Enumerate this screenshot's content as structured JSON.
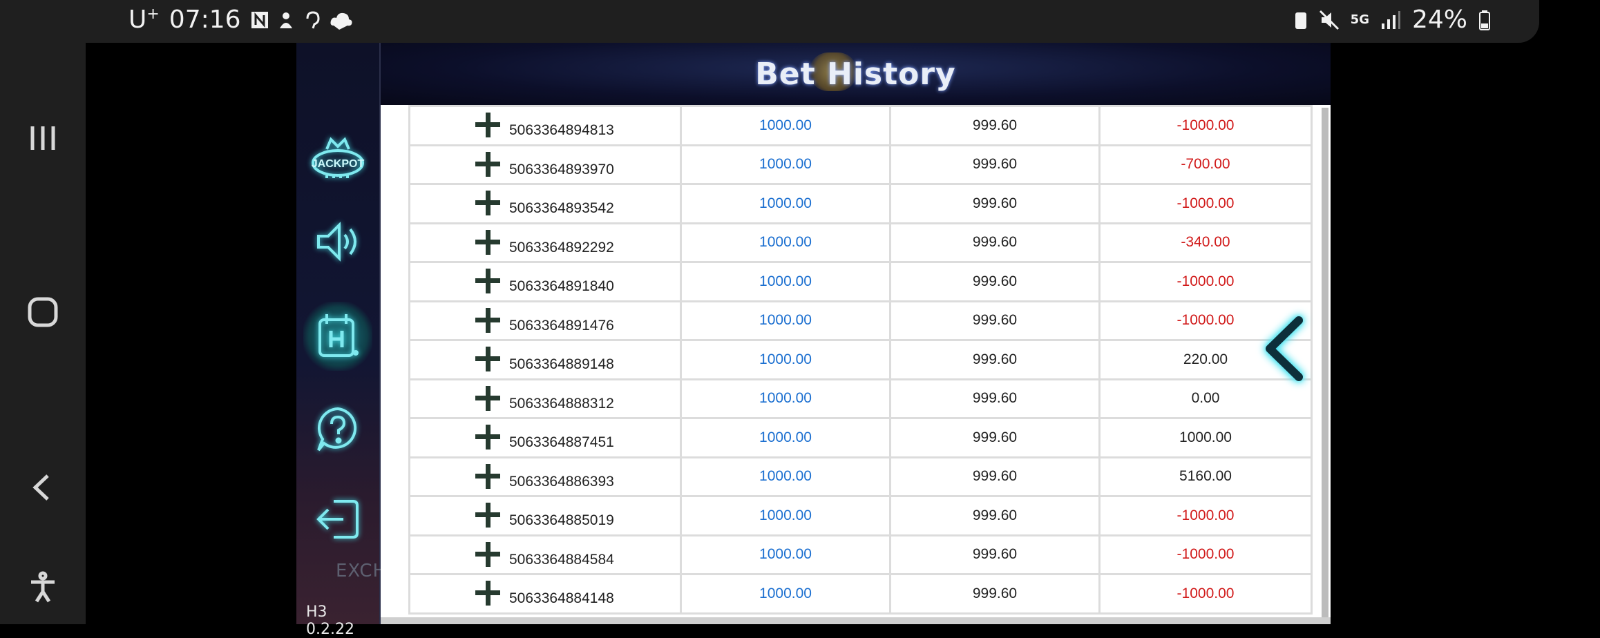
{
  "status_bar": {
    "carrier": "U",
    "carrier_sup": "+",
    "time": "07:16",
    "network": "5G",
    "battery": "24%"
  },
  "game": {
    "header_title": "Bet History",
    "version": "H3 0.2.22",
    "exchange_label": "EXCH",
    "sidebar": [
      {
        "name": "jackpot-icon",
        "label": "JACKPOT"
      },
      {
        "name": "sound-icon"
      },
      {
        "name": "history-icon"
      },
      {
        "name": "help-icon"
      },
      {
        "name": "exit-icon"
      }
    ]
  },
  "bets": [
    {
      "id": "5063364894813",
      "bet": "1000.00",
      "net": "999.60",
      "win": "-1000.00",
      "negative": true
    },
    {
      "id": "5063364893970",
      "bet": "1000.00",
      "net": "999.60",
      "win": "-700.00",
      "negative": true
    },
    {
      "id": "5063364893542",
      "bet": "1000.00",
      "net": "999.60",
      "win": "-1000.00",
      "negative": true
    },
    {
      "id": "5063364892292",
      "bet": "1000.00",
      "net": "999.60",
      "win": "-340.00",
      "negative": true
    },
    {
      "id": "5063364891840",
      "bet": "1000.00",
      "net": "999.60",
      "win": "-1000.00",
      "negative": true
    },
    {
      "id": "5063364891476",
      "bet": "1000.00",
      "net": "999.60",
      "win": "-1000.00",
      "negative": true
    },
    {
      "id": "5063364889148",
      "bet": "1000.00",
      "net": "999.60",
      "win": "220.00",
      "negative": false
    },
    {
      "id": "5063364888312",
      "bet": "1000.00",
      "net": "999.60",
      "win": "0.00",
      "negative": false
    },
    {
      "id": "5063364887451",
      "bet": "1000.00",
      "net": "999.60",
      "win": "1000.00",
      "negative": false
    },
    {
      "id": "5063364886393",
      "bet": "1000.00",
      "net": "999.60",
      "win": "5160.00",
      "negative": false
    },
    {
      "id": "5063364885019",
      "bet": "1000.00",
      "net": "999.60",
      "win": "-1000.00",
      "negative": true
    },
    {
      "id": "5063364884584",
      "bet": "1000.00",
      "net": "999.60",
      "win": "-1000.00",
      "negative": true
    },
    {
      "id": "5063364884148",
      "bet": "1000.00",
      "net": "999.60",
      "win": "-1000.00",
      "negative": true
    }
  ],
  "colors": {
    "bet_blue": "#1b6fd0",
    "negative_red": "#d11a1a",
    "neon_cyan": "#7fe9ef"
  }
}
